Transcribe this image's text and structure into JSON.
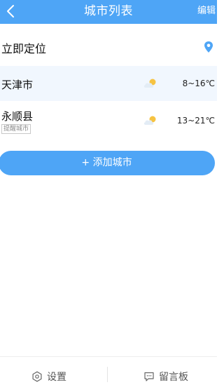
{
  "header": {
    "back_icon": "chevron-left-icon",
    "title": "城市列表",
    "edit_label": "编辑",
    "background": "#4ea5f6"
  },
  "locate": {
    "label": "立即定位",
    "icon": "location-pin-icon",
    "icon_color": "#4ea5f6"
  },
  "cities": [
    {
      "name": "天津市",
      "tag": "",
      "weather_icon": "partly-cloudy-icon",
      "temp": "8~16℃",
      "highlighted": true
    },
    {
      "name": "永顺县",
      "tag": "提醒城市",
      "weather_icon": "partly-cloudy-icon",
      "temp": "13~21℃",
      "highlighted": false
    }
  ],
  "add_button": {
    "label": "+ 添加城市"
  },
  "bottom_bar": {
    "settings_label": "设置",
    "settings_icon": "gear-icon",
    "message_label": "留言板",
    "message_icon": "message-icon"
  }
}
